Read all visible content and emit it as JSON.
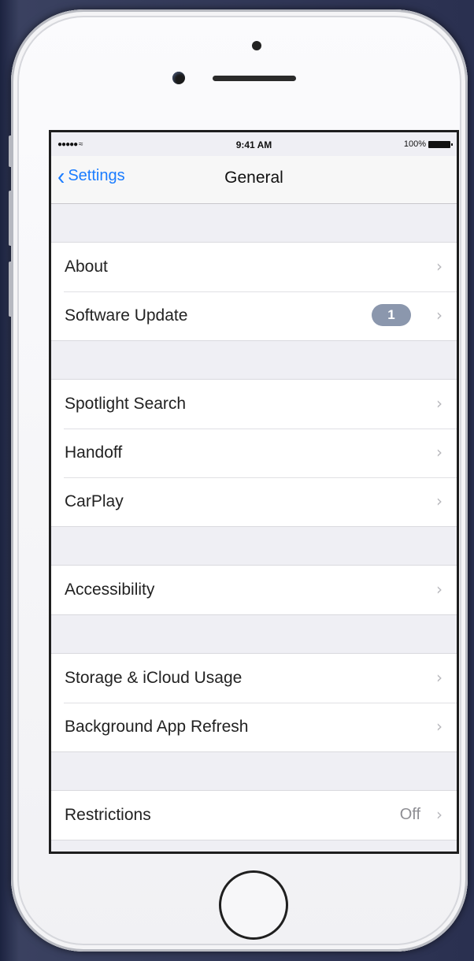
{
  "status_bar": {
    "signal": "●●●●● ≈",
    "time": "9:41 AM",
    "battery": "100%"
  },
  "nav": {
    "back_label": "Settings",
    "title": "General"
  },
  "groups": [
    [
      {
        "label": "About"
      },
      {
        "label": "Software Update",
        "badge": "1"
      }
    ],
    [
      {
        "label": "Spotlight Search"
      },
      {
        "label": "Handoff"
      },
      {
        "label": "CarPlay"
      }
    ],
    [
      {
        "label": "Accessibility"
      }
    ],
    [
      {
        "label": "Storage & iCloud Usage"
      },
      {
        "label": "Background App Refresh"
      }
    ],
    [
      {
        "label": "Restrictions",
        "value": "Off"
      }
    ]
  ],
  "icons": {
    "back": "chevron-left-icon",
    "disclosure": "chevron-right-icon"
  },
  "colors": {
    "accent": "#1a7cff",
    "badge": "#8b97ad",
    "background": "#efeff4"
  }
}
